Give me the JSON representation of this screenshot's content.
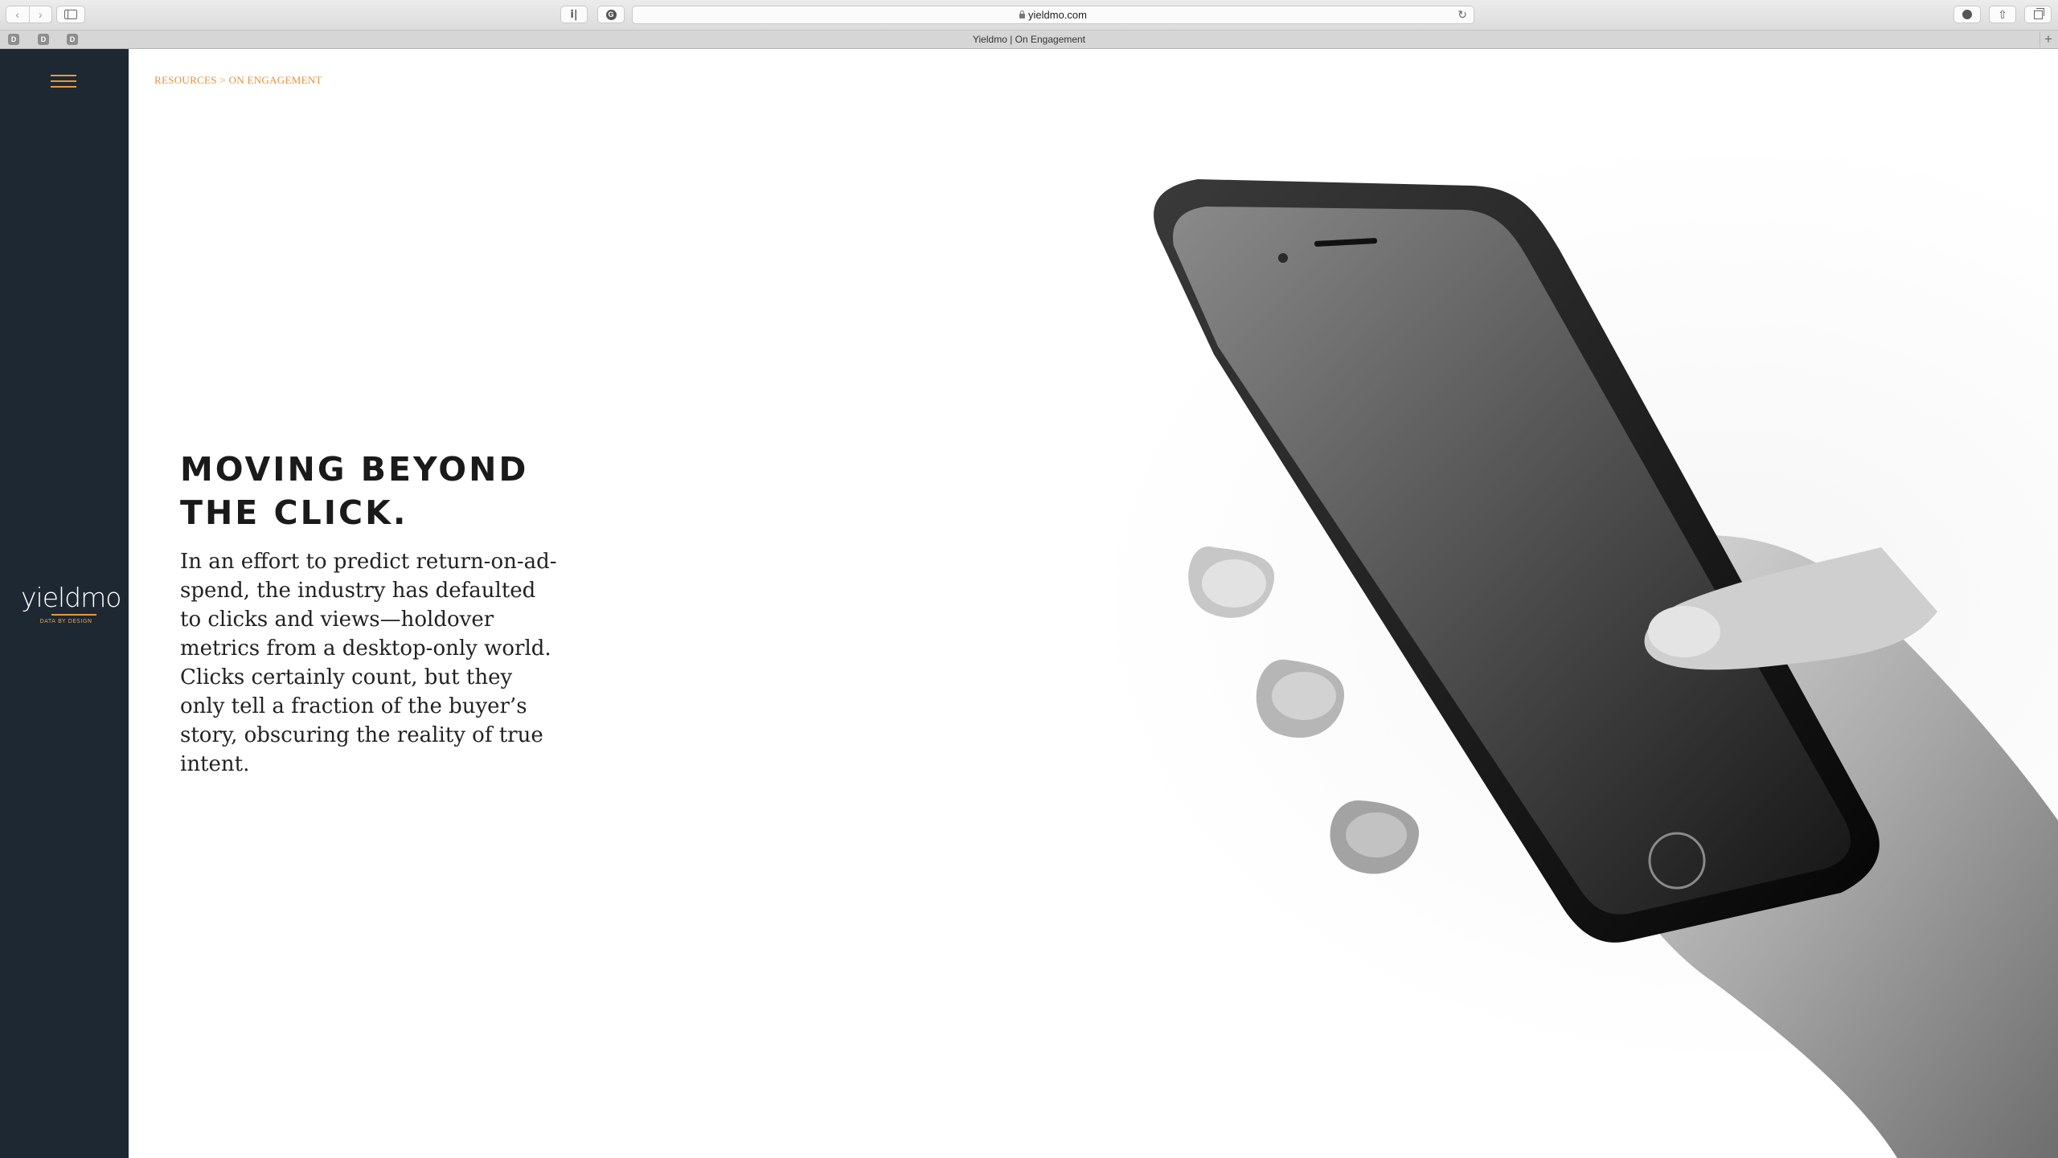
{
  "browser": {
    "url": "yieldmo.com",
    "tab_title": "Yieldmo | On Engagement",
    "favicons": [
      "D",
      "D",
      "D"
    ],
    "extension_icons": [
      "instapaper-icon",
      "grammarly-icon"
    ]
  },
  "sidebar": {
    "logo_text": "yieldmo",
    "logo_tagline": "DATA BY DESIGN",
    "accent_color": "#e59a3a",
    "background_color": "#1e2833"
  },
  "breadcrumb": {
    "text": "RESOURCES > ON ENGAGEMENT"
  },
  "article": {
    "headline_line1": "MOVING BEYOND",
    "headline_line2": "THE CLICK.",
    "body": "In an effort to predict return-on-ad-spend, the industry has defaulted to clicks and views—holdover metrics from a desktop-only world. Clicks certainly count, but they only tell a fraction of the buyer’s story, obscuring the reality of true intent."
  },
  "hero_image": {
    "subject": "hand-holding-smartphone-photo"
  }
}
